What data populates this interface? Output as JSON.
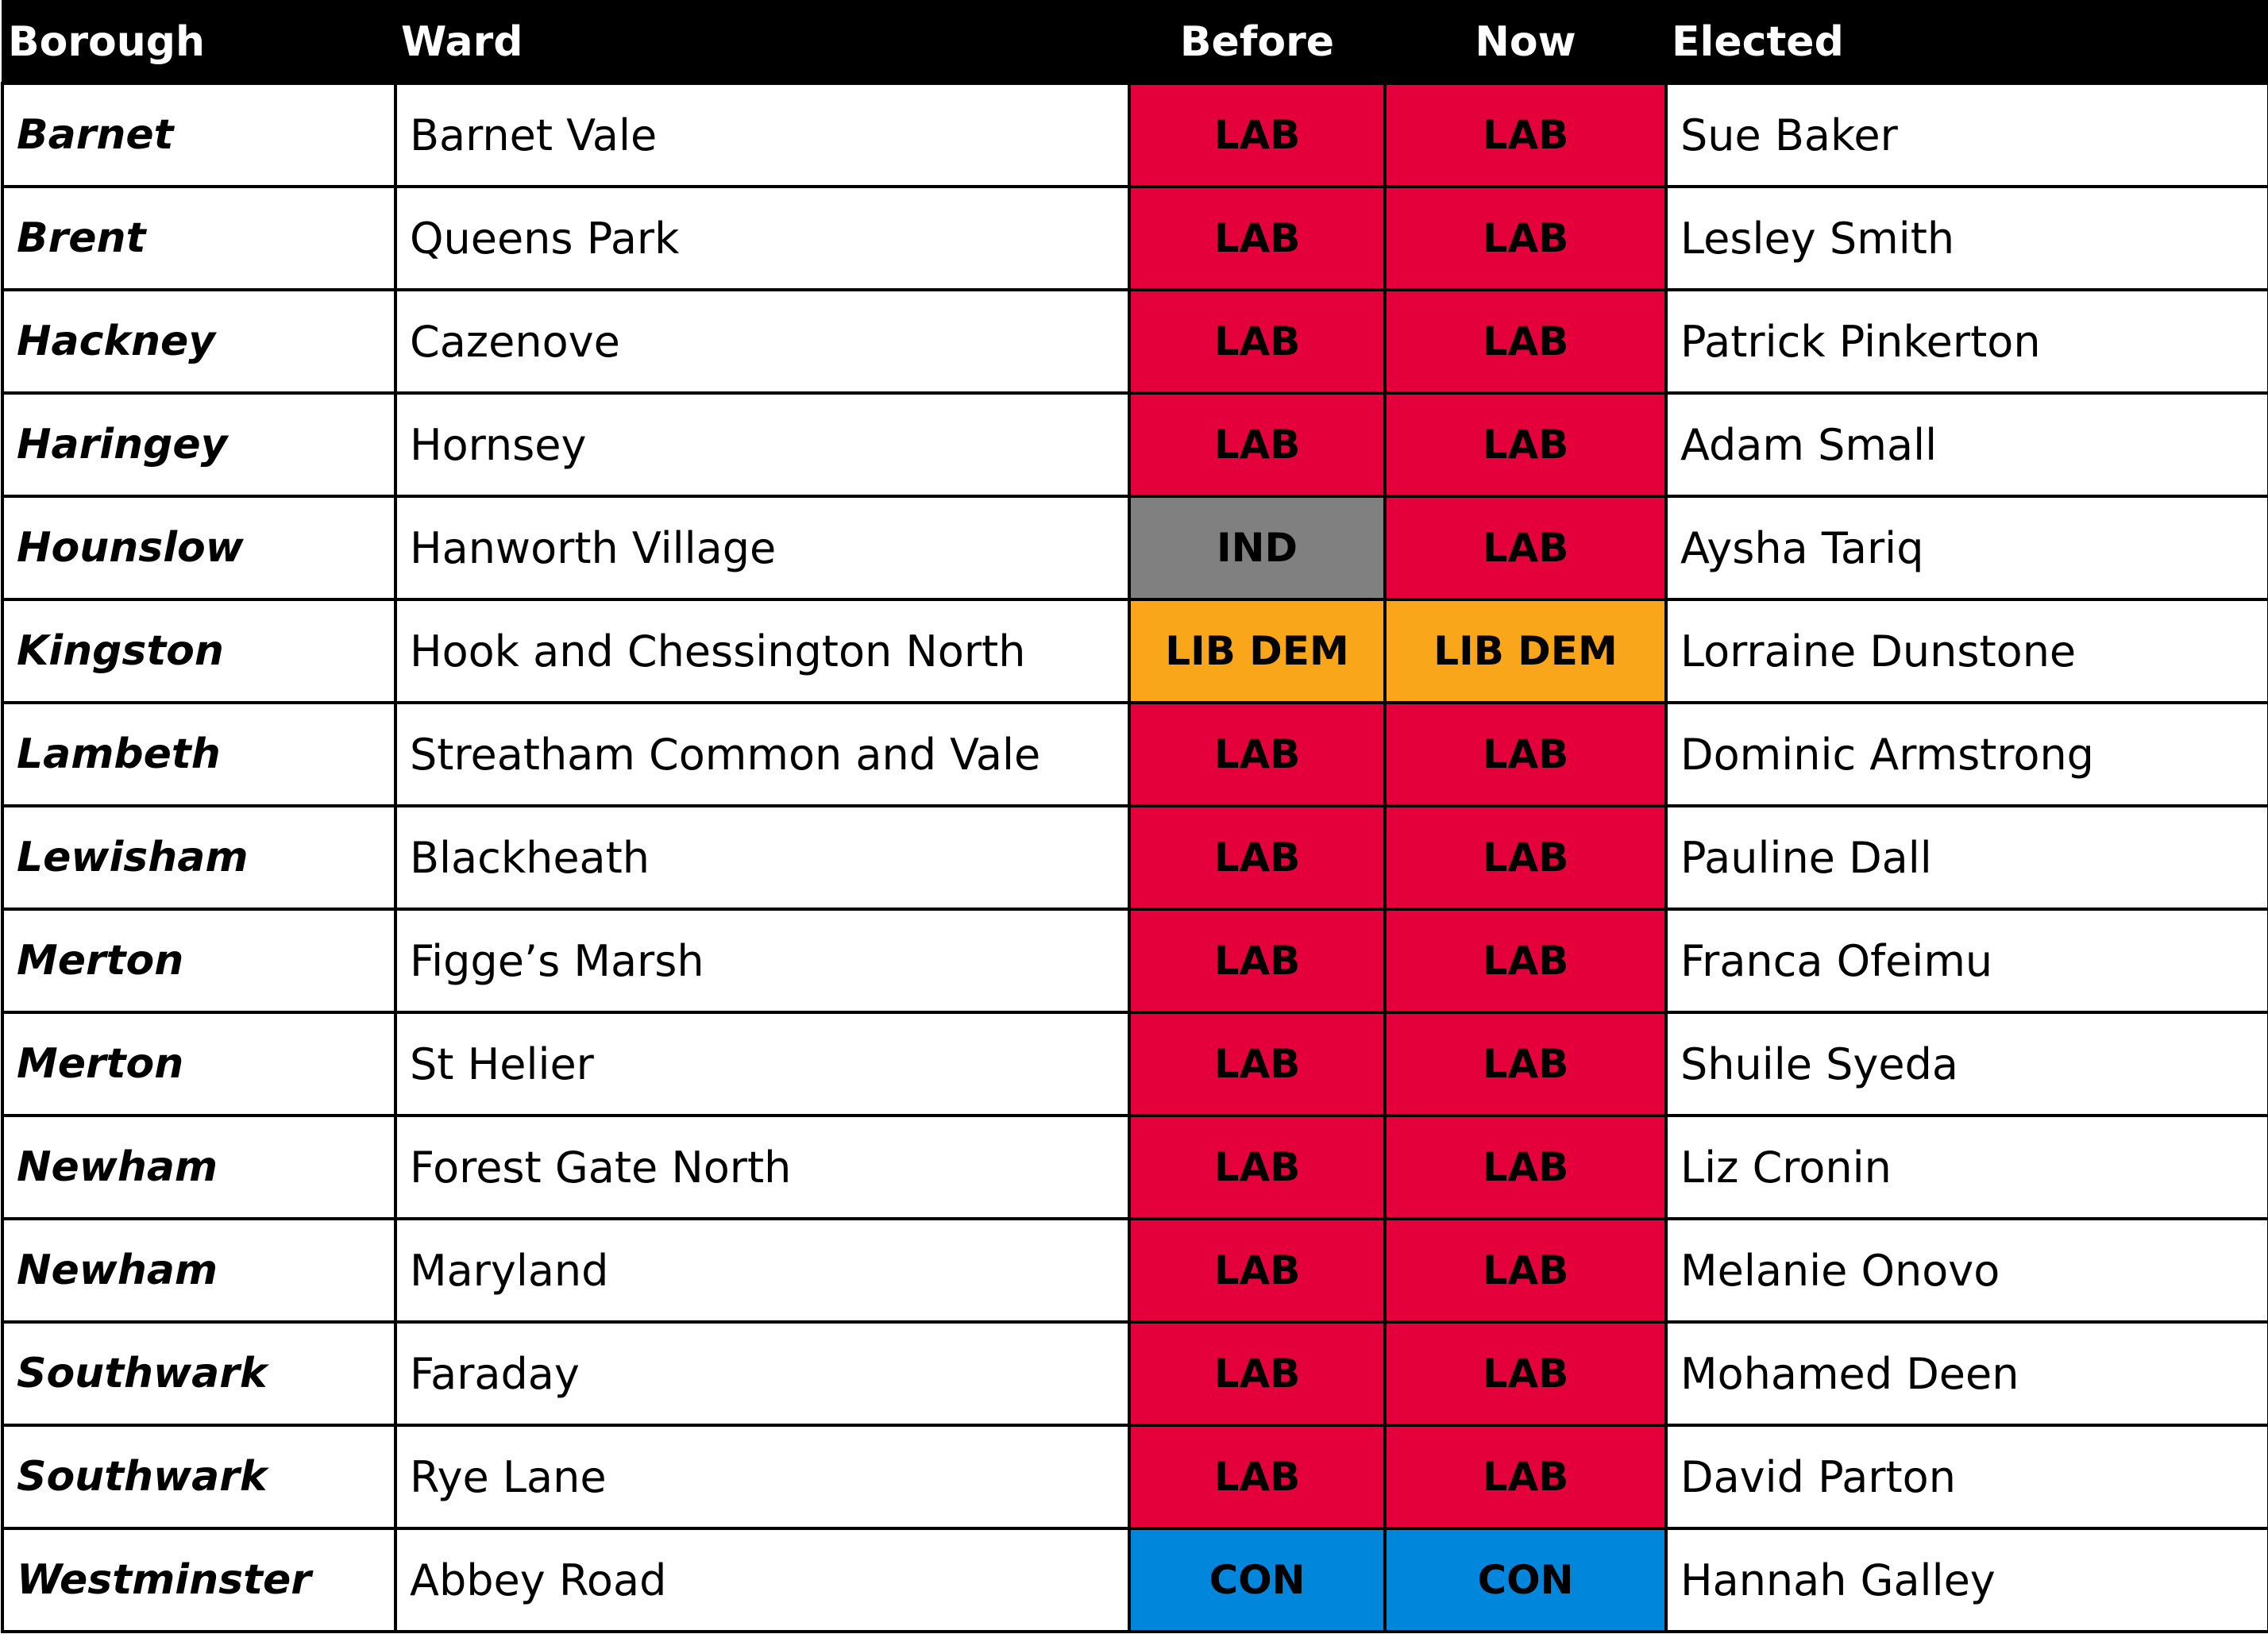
{
  "headers": {
    "borough": "Borough",
    "ward": "Ward",
    "before": "Before",
    "now": "Now",
    "elected": "Elected"
  },
  "party_colors": {
    "LAB": "#E4003B",
    "IND": "#808080",
    "LIB DEM": "#FAA61A",
    "CON": "#0087DC"
  },
  "rows": [
    {
      "borough": "Barnet",
      "ward": "Barnet Vale",
      "before": "LAB",
      "now": "LAB",
      "elected": "Sue Baker"
    },
    {
      "borough": "Brent",
      "ward": "Queens Park",
      "before": "LAB",
      "now": "LAB",
      "elected": "Lesley Smith"
    },
    {
      "borough": "Hackney",
      "ward": "Cazenove",
      "before": "LAB",
      "now": "LAB",
      "elected": "Patrick Pinkerton"
    },
    {
      "borough": "Haringey",
      "ward": "Hornsey",
      "before": "LAB",
      "now": "LAB",
      "elected": "Adam Small"
    },
    {
      "borough": "Hounslow",
      "ward": "Hanworth Village",
      "before": "IND",
      "now": "LAB",
      "elected": "Aysha Tariq"
    },
    {
      "borough": "Kingston",
      "ward": "Hook and Chessington North",
      "before": "LIB DEM",
      "now": "LIB DEM",
      "elected": "Lorraine Dunstone"
    },
    {
      "borough": "Lambeth",
      "ward": "Streatham Common and Vale",
      "before": "LAB",
      "now": "LAB",
      "elected": "Dominic Armstrong"
    },
    {
      "borough": "Lewisham",
      "ward": "Blackheath",
      "before": "LAB",
      "now": "LAB",
      "elected": "Pauline Dall"
    },
    {
      "borough": "Merton",
      "ward": "Figge’s Marsh",
      "before": "LAB",
      "now": "LAB",
      "elected": "Franca Ofeimu"
    },
    {
      "borough": "Merton",
      "ward": "St Helier",
      "before": "LAB",
      "now": "LAB",
      "elected": "Shuile Syeda"
    },
    {
      "borough": "Newham",
      "ward": "Forest Gate North",
      "before": "LAB",
      "now": "LAB",
      "elected": "Liz Cronin"
    },
    {
      "borough": "Newham",
      "ward": "Maryland",
      "before": "LAB",
      "now": "LAB",
      "elected": "Melanie Onovo"
    },
    {
      "borough": "Southwark",
      "ward": "Faraday",
      "before": "LAB",
      "now": "LAB",
      "elected": "Mohamed Deen"
    },
    {
      "borough": "Southwark",
      "ward": "Rye Lane",
      "before": "LAB",
      "now": "LAB",
      "elected": "David Parton"
    },
    {
      "borough": "Westminster",
      "ward": "Abbey Road",
      "before": "CON",
      "now": "CON",
      "elected": "Hannah Galley"
    }
  ]
}
